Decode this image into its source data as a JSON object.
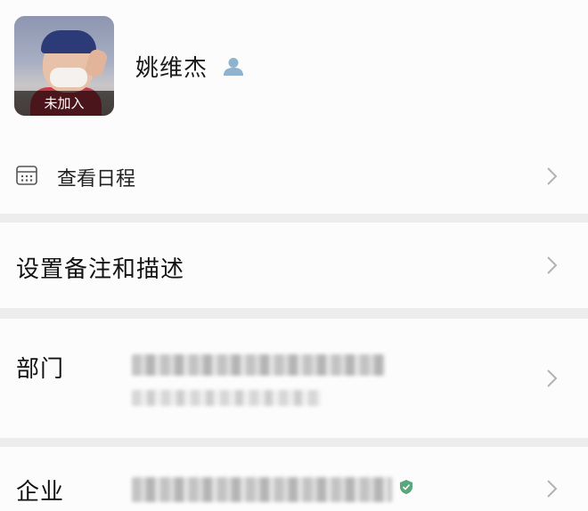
{
  "profile": {
    "avatar_status": "未加入",
    "name": "姚维杰",
    "name_icon": "user-icon"
  },
  "schedule": {
    "icon": "calendar-icon",
    "label": "查看日程",
    "chevron": "chevron-right-icon"
  },
  "remark": {
    "label": "设置备注和描述"
  },
  "department": {
    "label": "部门"
  },
  "enterprise": {
    "label": "企业",
    "verified_icon": "shield-check-icon"
  },
  "colors": {
    "background": "#ededed",
    "section": "#fcfcfc",
    "chevron": "#b2b2b2",
    "user_icon": "#8fb3cf",
    "verified": "#5aa77d"
  }
}
